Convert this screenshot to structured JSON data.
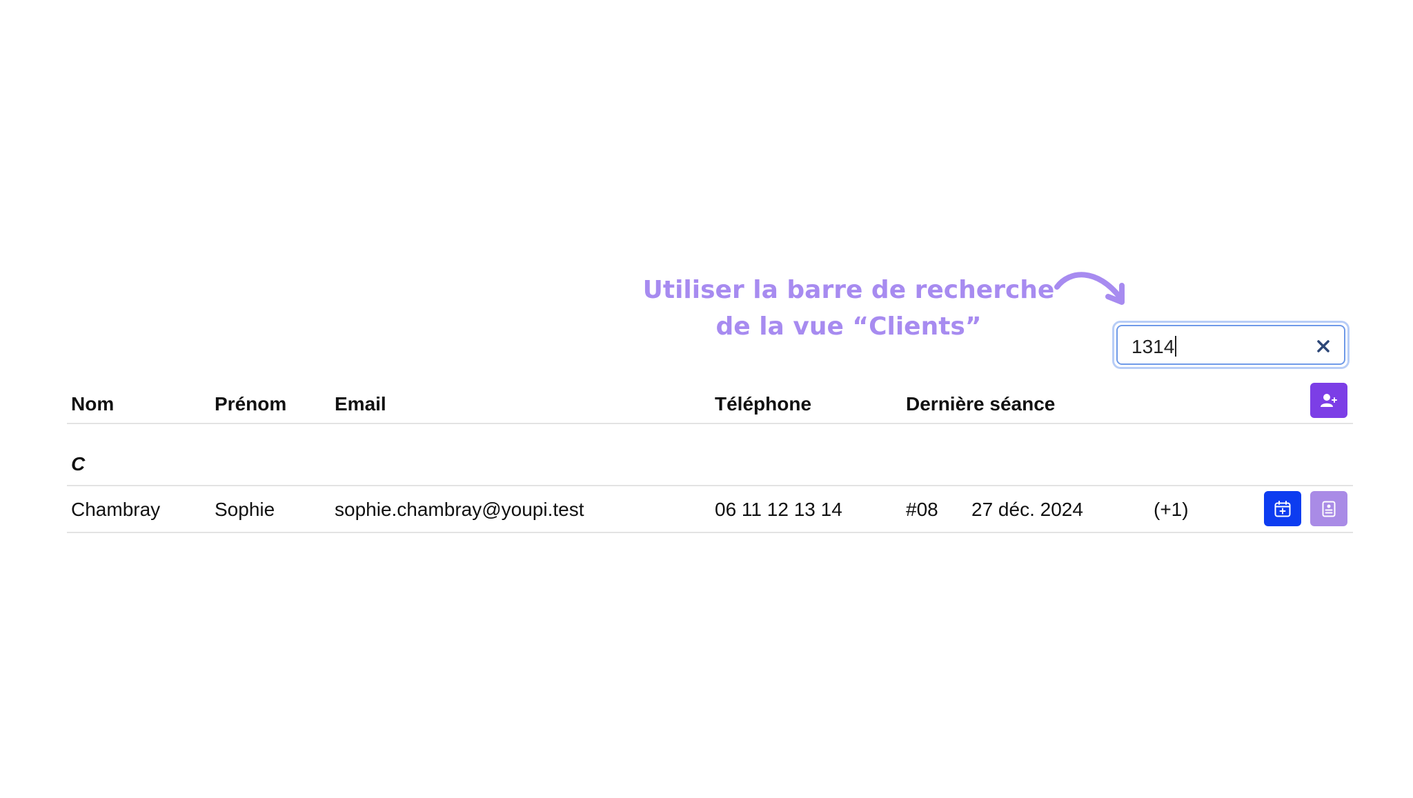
{
  "annotation": {
    "line1": "Utiliser la barre de recherche",
    "line2": "de la vue “Clients”"
  },
  "search": {
    "value": "1314",
    "clear_icon": "close-icon"
  },
  "table": {
    "columns": {
      "nom": "Nom",
      "prenom": "Prénom",
      "email": "Email",
      "telephone": "Téléphone",
      "derniere_seance": "Dernière séance"
    },
    "add_client_icon": "user-plus-icon",
    "group_letter": "C",
    "rows": [
      {
        "nom": "Chambray",
        "prenom": "Sophie",
        "email": "sophie.chambray@youpi.test",
        "telephone": "06 11 12 13 14",
        "seance_number": "#08",
        "seance_date": "27 déc. 2024",
        "seance_extra": "(+1)",
        "calendar_icon": "calendar-plus-icon",
        "contact_icon": "contact-card-icon"
      }
    ]
  },
  "colors": {
    "annotation": "#a78bf0",
    "primary_purple": "#7c3ee6",
    "calendar_blue": "#0d3cf0",
    "light_purple": "#a98be6",
    "search_focus": "#6f9ae8"
  }
}
